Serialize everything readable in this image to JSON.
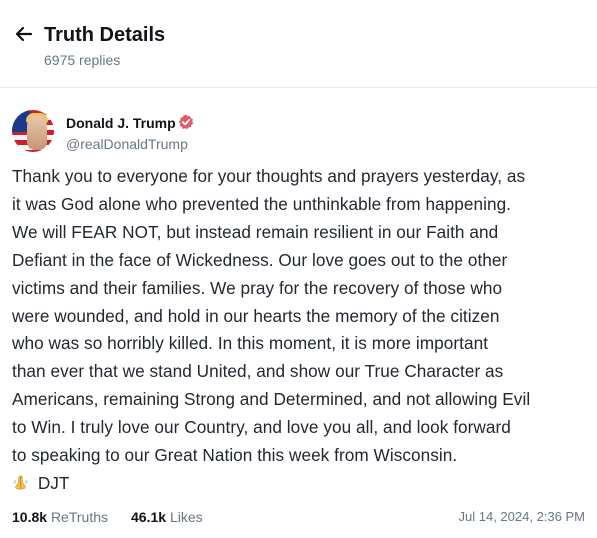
{
  "header": {
    "title": "Truth Details",
    "replies": "6975 replies"
  },
  "author": {
    "display_name": "Donald J. Trump",
    "handle": "@realDonaldTrump",
    "verified_color": "#e25d6b"
  },
  "post": {
    "lines": [
      "Thank you to everyone for your thoughts and prayers yesterday, as",
      "it was God alone who prevented the unthinkable from happening.",
      "We will FEAR NOT, but instead remain resilient in our Faith and",
      "Defiant in the face of Wickedness. Our love goes out to the other",
      "victims and their families. We pray for the recovery of those who",
      "were wounded, and hold in our hearts the memory of the citizen",
      "who was so horribly killed. In this moment, it is more important",
      "than ever that we stand United, and show our True Character as",
      "Americans, remaining Strong and Determined, and not allowing Evil",
      "to Win. I truly love our Country, and love you all, and look forward",
      "to speaking to our Great Nation this week from Wisconsin."
    ],
    "signature": "DJT",
    "signature_icon": "praying-hands-emoji"
  },
  "stats": {
    "retruths_count": "10.8k",
    "retruths_label": "ReTruths",
    "likes_count": "46.1k",
    "likes_label": "Likes",
    "timestamp": "Jul 14, 2024, 2:36 PM"
  }
}
